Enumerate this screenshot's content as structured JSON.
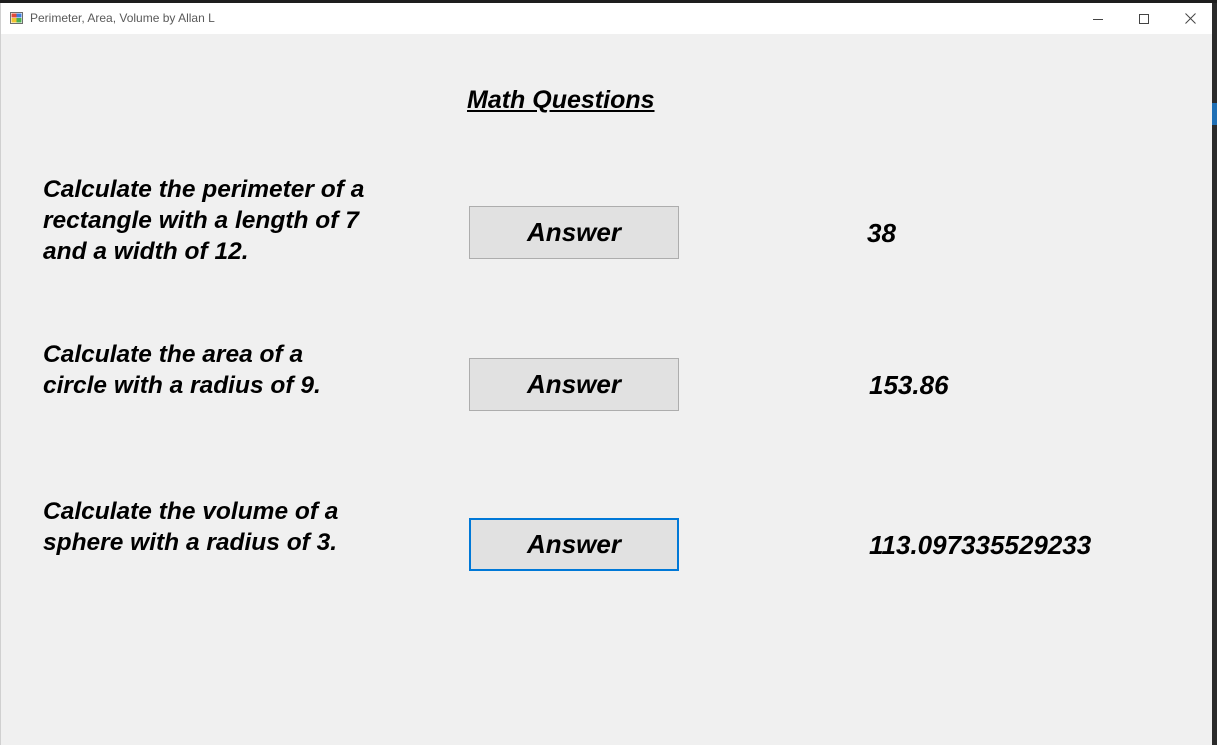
{
  "window": {
    "title": "Perimeter, Area, Volume by Allan L",
    "icon": "form-app-icon",
    "controls": [
      "minimize-icon",
      "maximize-icon",
      "close-icon"
    ]
  },
  "main": {
    "heading": "Math Questions",
    "rows": [
      {
        "question": "Calculate the perimeter of a\nrectangle with a length of 7\nand a width of 12.",
        "button_label": "Answer",
        "result": "38"
      },
      {
        "question": "Calculate the area of a\ncircle with a radius of 9.",
        "button_label": "Answer",
        "result": "153.86"
      },
      {
        "question": "Calculate the volume of a\nsphere with a radius of 3.",
        "button_label": "Answer",
        "result": "113.097335529233"
      }
    ]
  },
  "colors": {
    "background": "#f0f0f0",
    "button_face": "#e1e1e1",
    "focus_border": "#0078d7"
  }
}
